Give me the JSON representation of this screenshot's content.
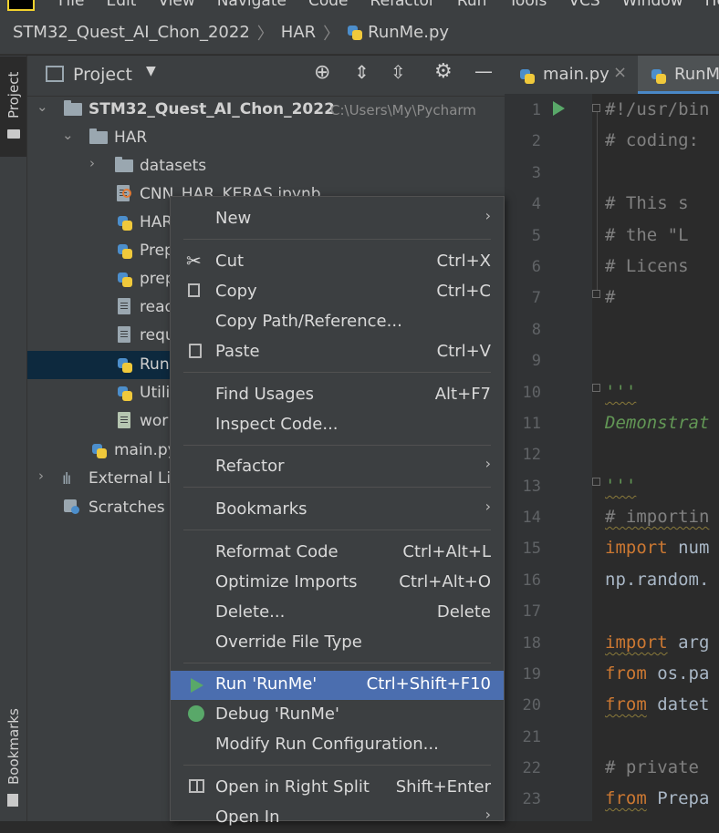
{
  "menubar": {
    "items": [
      "File",
      "Edit",
      "View",
      "Navigate",
      "Code",
      "Refactor",
      "Run",
      "Tools",
      "VCS",
      "Window",
      "Help"
    ]
  },
  "breadcrumb": [
    "STM32_Quest_AI_Chon_2022",
    "HAR",
    "RunMe.py"
  ],
  "left_stripe": {
    "project": "Project",
    "bookmarks": "Bookmarks"
  },
  "project_panel": {
    "title": "Project",
    "tree": [
      {
        "label": "STM32_Quest_AI_Chon_2022",
        "path": "C:\\Users\\My\\Pycharm"
      },
      {
        "label": "HAR"
      },
      {
        "label": "datasets"
      },
      {
        "label": "CNN_HAR_KERAS.ipynb"
      },
      {
        "label": "HAR"
      },
      {
        "label": "Prep"
      },
      {
        "label": "prep"
      },
      {
        "label": "read"
      },
      {
        "label": "requ"
      },
      {
        "label": "Run"
      },
      {
        "label": "Utili"
      },
      {
        "label": "wor"
      },
      {
        "label": "main.py"
      },
      {
        "label": "External Li"
      },
      {
        "label": "Scratches a"
      }
    ]
  },
  "editor": {
    "tabs": [
      {
        "label": "main.py",
        "close": "×"
      },
      {
        "label": "RunM"
      }
    ],
    "lines": [
      {
        "n": "1",
        "text": "#!/usr/bin"
      },
      {
        "n": "2",
        "text": "# coding:"
      },
      {
        "n": "3",
        "text": ""
      },
      {
        "n": "4",
        "text": "#   This s"
      },
      {
        "n": "5",
        "text": "#   the \"L"
      },
      {
        "n": "6",
        "text": "#   Licens"
      },
      {
        "n": "7",
        "text": "#"
      },
      {
        "n": "8",
        "text": ""
      },
      {
        "n": "9",
        "text": ""
      },
      {
        "n": "10",
        "text": "'''"
      },
      {
        "n": "11",
        "text": "Demonstrat"
      },
      {
        "n": "12",
        "text": ""
      },
      {
        "n": "13",
        "text": "'''"
      },
      {
        "n": "14",
        "text": "# importin"
      },
      {
        "n": "15",
        "kw": "import",
        "rest": " num"
      },
      {
        "n": "16",
        "text": "np.random."
      },
      {
        "n": "17",
        "text": ""
      },
      {
        "n": "18",
        "kw": "import",
        "rest": " arg"
      },
      {
        "n": "19",
        "kw": "from",
        "rest": " os.pa"
      },
      {
        "n": "20",
        "kw": "from",
        "rest": " datet"
      },
      {
        "n": "21",
        "text": ""
      },
      {
        "n": "22",
        "text": "# private"
      },
      {
        "n": "23",
        "kw": "from",
        "rest": " Prepa"
      }
    ]
  },
  "context_menu": {
    "new": "New",
    "cut": {
      "label": "Cut",
      "shortcut": "Ctrl+X"
    },
    "copy": {
      "label": "Copy",
      "shortcut": "Ctrl+C"
    },
    "copy_path": "Copy Path/Reference...",
    "paste": {
      "label": "Paste",
      "shortcut": "Ctrl+V"
    },
    "find_usages": {
      "label": "Find Usages",
      "shortcut": "Alt+F7"
    },
    "inspect_code": "Inspect Code...",
    "refactor": "Refactor",
    "bookmarks": "Bookmarks",
    "reformat": {
      "label": "Reformat Code",
      "shortcut": "Ctrl+Alt+L"
    },
    "optimize": {
      "label": "Optimize Imports",
      "shortcut": "Ctrl+Alt+O"
    },
    "delete": {
      "label": "Delete...",
      "shortcut": "Delete"
    },
    "override": "Override File Type",
    "run": {
      "label": "Run 'RunMe'",
      "shortcut": "Ctrl+Shift+F10"
    },
    "debug": "Debug 'RunMe'",
    "modify_run": "Modify Run Configuration...",
    "open_split": {
      "label": "Open in Right Split",
      "shortcut": "Shift+Enter"
    },
    "open_in": "Open In"
  },
  "colors": {
    "highlight": "#4b6eaf",
    "run_green": "#59a869",
    "debug_green": "#59a869",
    "selected_row": "#0d293e"
  }
}
